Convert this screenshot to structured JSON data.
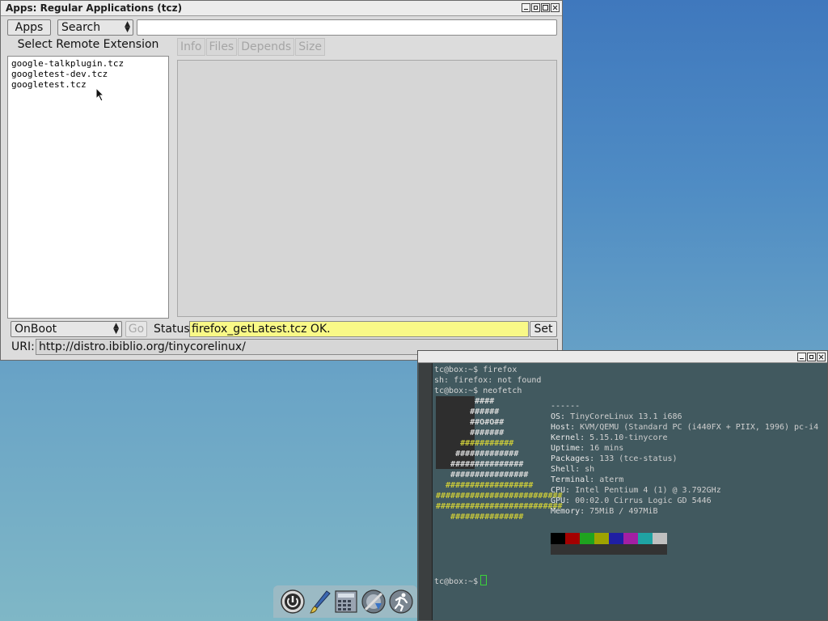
{
  "apps_window": {
    "title": "Apps: Regular Applications (tcz)",
    "apps_button": "Apps",
    "search_select": "Search",
    "search_value": "",
    "extension_list_label": "Select Remote Extension",
    "extensions": [
      "google-talkplugin.tcz",
      "googletest-dev.tcz",
      "googletest.tcz"
    ],
    "tabs": [
      "Info",
      "Files",
      "Depends",
      "Size"
    ],
    "install_mode": "OnBoot",
    "go_button": "Go",
    "status_label": "Status",
    "status_value": "firefox_getLatest.tcz OK.",
    "set_button": "Set",
    "uri_label": "URI:",
    "uri_value": "http://distro.ibiblio.org/tinycorelinux/"
  },
  "terminal": {
    "lines": [
      "tc@box:~$ firefox",
      "sh: firefox: not found",
      "tc@box:~$ neofetch"
    ],
    "separator": "------",
    "info": [
      {
        "key": "OS:",
        "value": "TinyCoreLinux 13.1 i686"
      },
      {
        "key": "Host:",
        "value": "KVM/QEMU (Standard PC (i440FX + PIIX, 1996) pc-i4"
      },
      {
        "key": "Kernel:",
        "value": "5.15.10-tinycore"
      },
      {
        "key": "Uptime:",
        "value": "16 mins"
      },
      {
        "key": "Packages:",
        "value": "133 (tce-status)"
      },
      {
        "key": "Shell:",
        "value": "sh"
      },
      {
        "key": "Terminal:",
        "value": "aterm"
      },
      {
        "key": "CPU:",
        "value": "Intel Pentium 4 (1) @ 3.792GHz"
      },
      {
        "key": "GPU:",
        "value": "00:02.0 Cirrus Logic GD 5446"
      },
      {
        "key": "Memory:",
        "value": "75MiB / 497MiB"
      }
    ],
    "logo_lines": [
      "        ####",
      "       ######",
      "       ##O#O##",
      "       #######",
      "     ###########",
      "    #############",
      "   ###############",
      "   ################",
      "  ##################",
      "##########################",
      "##########################",
      "   ###############"
    ],
    "palette": [
      "#000000",
      "#a40000",
      "#1fa31f",
      "#9ea300",
      "#1f1fa3",
      "#a31fa3",
      "#1fa3a3",
      "#c0c0c0"
    ],
    "prompt": "tc@box:~$"
  },
  "dock": {
    "icons": [
      "power-icon",
      "paintbrush-icon",
      "calculator-icon",
      "apps-install-icon",
      "run-icon"
    ]
  }
}
